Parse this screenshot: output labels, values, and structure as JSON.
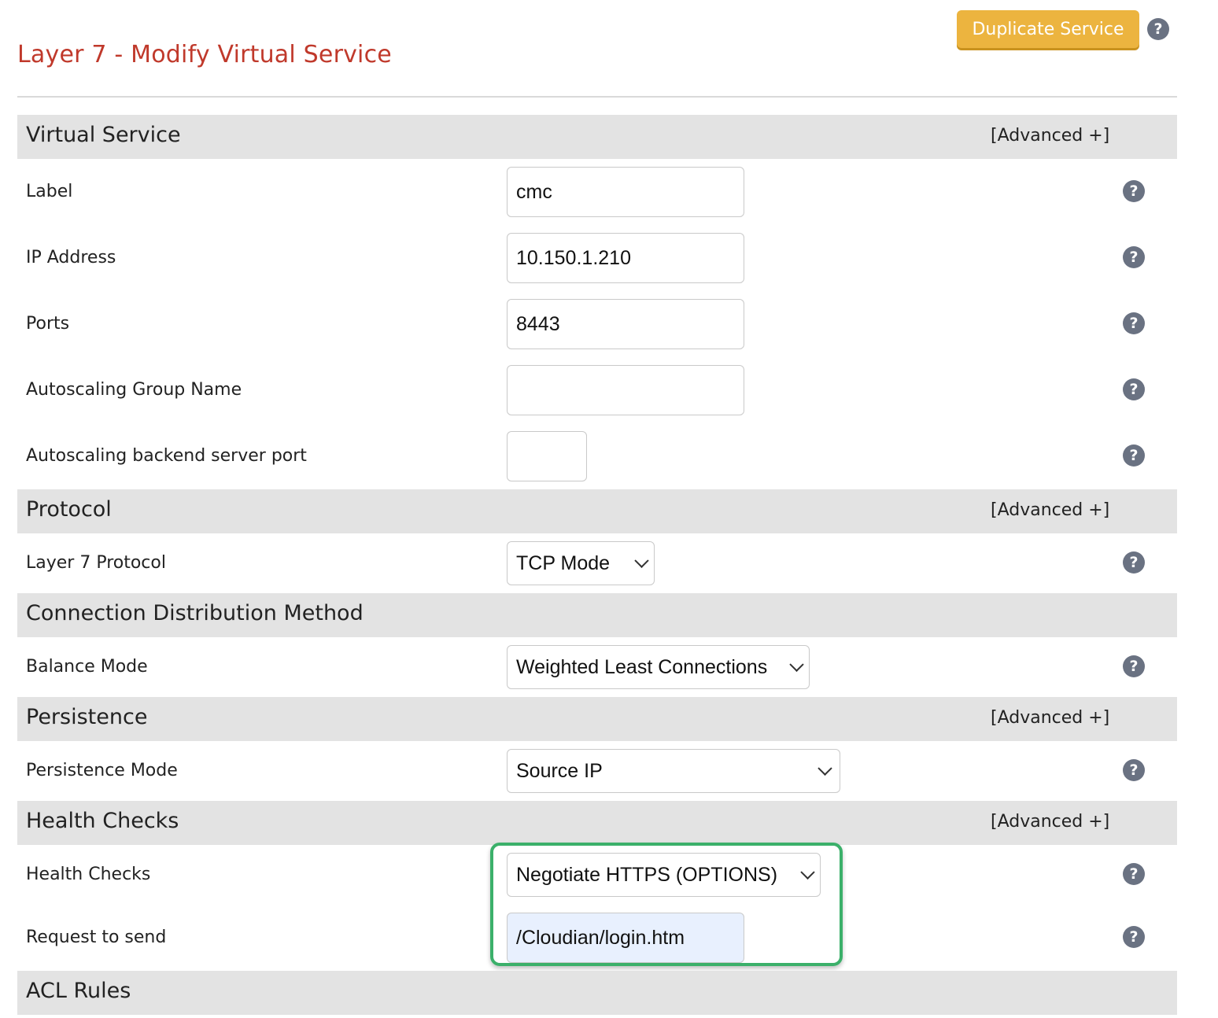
{
  "page": {
    "title": "Layer 7 - Modify Virtual Service",
    "duplicate_button": "Duplicate Service",
    "help_glyph": "?"
  },
  "sections": {
    "virtual_service": {
      "title": "Virtual Service",
      "advanced": "[Advanced +]"
    },
    "protocol": {
      "title": "Protocol",
      "advanced": "[Advanced +]"
    },
    "connection": {
      "title": "Connection Distribution Method"
    },
    "persistence": {
      "title": "Persistence",
      "advanced": "[Advanced +]"
    },
    "health": {
      "title": "Health Checks",
      "advanced": "[Advanced +]"
    },
    "acl": {
      "title": "ACL Rules"
    }
  },
  "fields": {
    "label": {
      "label": "Label",
      "value": "cmc"
    },
    "ip": {
      "label": "IP Address",
      "value": "10.150.1.210"
    },
    "ports": {
      "label": "Ports",
      "value": "8443"
    },
    "asg_name": {
      "label": "Autoscaling Group Name",
      "value": ""
    },
    "asg_port": {
      "label": "Autoscaling backend server port",
      "value": ""
    },
    "l7_protocol": {
      "label": "Layer 7 Protocol",
      "value": "TCP Mode"
    },
    "balance_mode": {
      "label": "Balance Mode",
      "value": "Weighted Least Connections"
    },
    "persistence_mode": {
      "label": "Persistence Mode",
      "value": "Source IP"
    },
    "health_checks": {
      "label": "Health Checks",
      "value": "Negotiate HTTPS (OPTIONS)"
    },
    "request": {
      "label": "Request to send",
      "value": "/Cloudian/login.htm"
    }
  },
  "colors": {
    "title": "#c0392b",
    "button": "#ecb43f",
    "section_bg": "#e3e3e3",
    "help_icon": "#6a7282",
    "highlight_border": "#3bb06a",
    "autofill_bg": "#e8f0fe"
  }
}
